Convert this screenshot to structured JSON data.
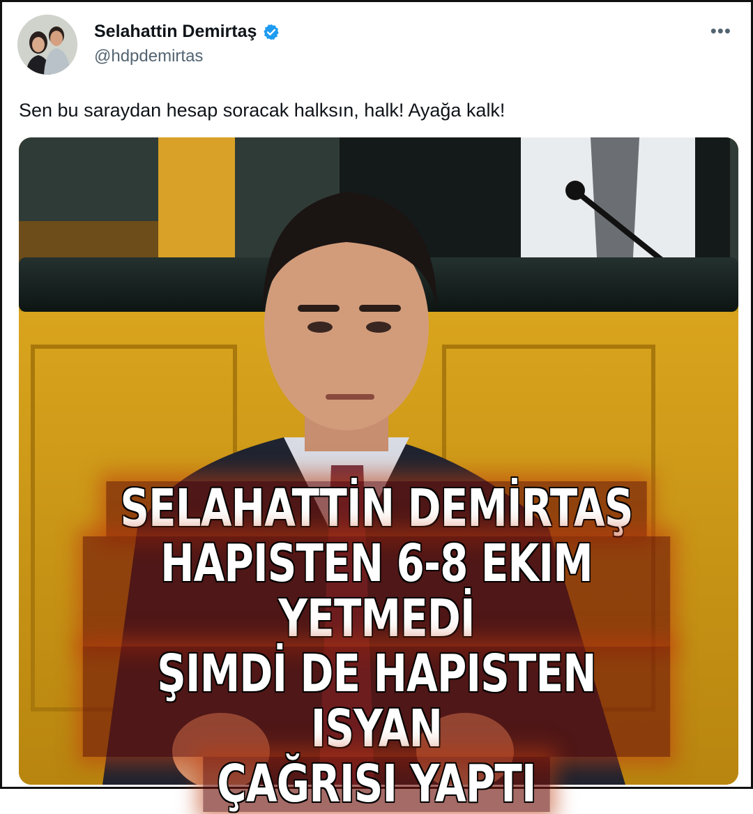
{
  "tweet": {
    "display_name": "Selahattin Demirtaş",
    "handle": "@hdpdemirtas",
    "text": "Sen bu saraydan hesap soracak halksın, halk! Ayağa kalk!",
    "more_icon": "more-horizontal-icon",
    "verified_icon": "verified-badge-icon",
    "verified_color": "#1d9bf0"
  },
  "overlay": {
    "lines": [
      "SELAHATTİN DEMİRTAŞ",
      "HAPISTEN 6-8 EKIM YETMEDİ",
      "ŞIMDİ DE HAPISTEN ISYAN",
      "ÇAĞRISI YAPTI"
    ]
  }
}
